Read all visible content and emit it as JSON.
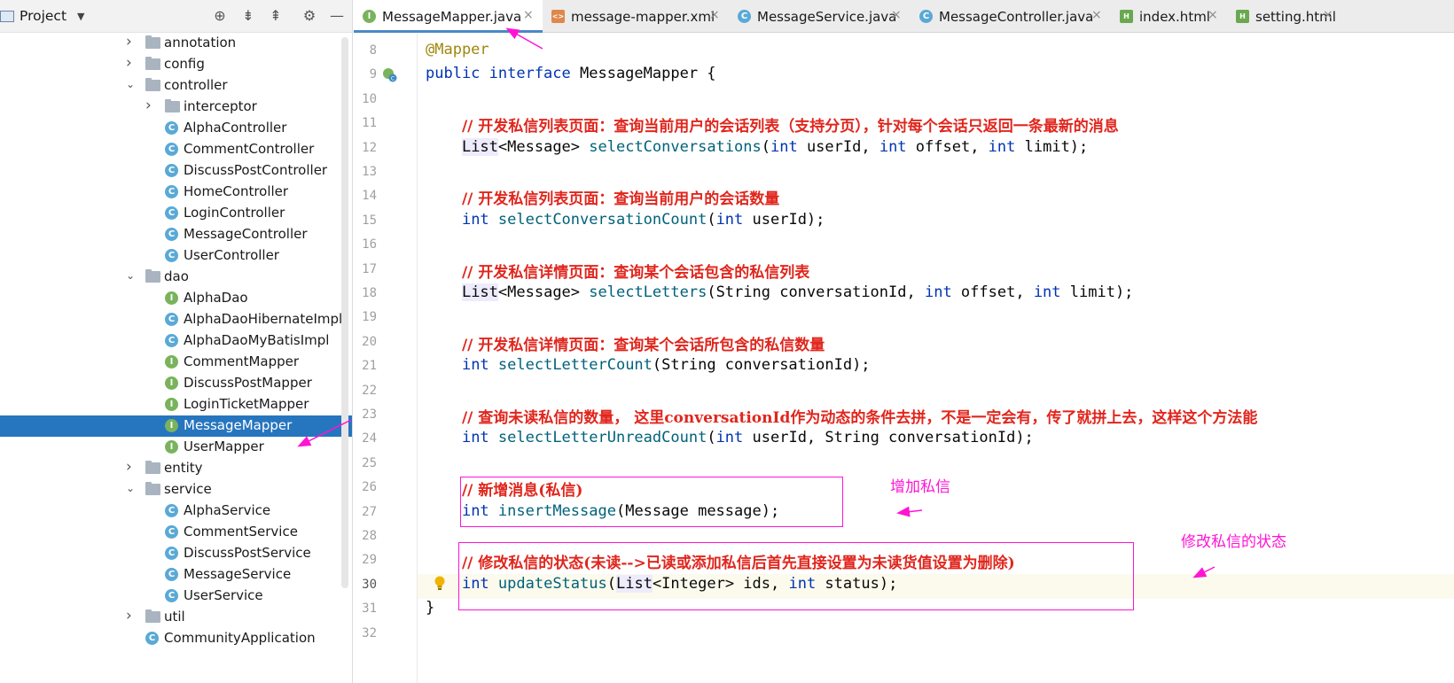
{
  "project_panel": {
    "title": "Project",
    "tools": [
      "locate-icon",
      "expand-all-icon",
      "collapse-all-icon",
      "gear-icon",
      "minimize-icon"
    ],
    "tree": [
      {
        "label": "annotation",
        "kind": "folder",
        "depth": 1,
        "expanded": false
      },
      {
        "label": "config",
        "kind": "folder",
        "depth": 1,
        "expanded": false
      },
      {
        "label": "controller",
        "kind": "folder",
        "depth": 1,
        "expanded": true
      },
      {
        "label": "interceptor",
        "kind": "folder",
        "depth": 2,
        "expanded": false
      },
      {
        "label": "AlphaController",
        "kind": "class",
        "depth": 2
      },
      {
        "label": "CommentController",
        "kind": "class",
        "depth": 2
      },
      {
        "label": "DiscussPostController",
        "kind": "class",
        "depth": 2
      },
      {
        "label": "HomeController",
        "kind": "class",
        "depth": 2
      },
      {
        "label": "LoginController",
        "kind": "class",
        "depth": 2
      },
      {
        "label": "MessageController",
        "kind": "class",
        "depth": 2
      },
      {
        "label": "UserController",
        "kind": "class",
        "depth": 2
      },
      {
        "label": "dao",
        "kind": "folder",
        "depth": 1,
        "expanded": true
      },
      {
        "label": "AlphaDao",
        "kind": "interface",
        "depth": 2
      },
      {
        "label": "AlphaDaoHibernateImpl",
        "kind": "class",
        "depth": 2
      },
      {
        "label": "AlphaDaoMyBatisImpl",
        "kind": "class",
        "depth": 2
      },
      {
        "label": "CommentMapper",
        "kind": "interface",
        "depth": 2
      },
      {
        "label": "DiscussPostMapper",
        "kind": "interface",
        "depth": 2
      },
      {
        "label": "LoginTicketMapper",
        "kind": "interface",
        "depth": 2
      },
      {
        "label": "MessageMapper",
        "kind": "interface",
        "depth": 2,
        "selected": true
      },
      {
        "label": "UserMapper",
        "kind": "interface",
        "depth": 2
      },
      {
        "label": "entity",
        "kind": "folder",
        "depth": 1,
        "expanded": false
      },
      {
        "label": "service",
        "kind": "folder",
        "depth": 1,
        "expanded": true
      },
      {
        "label": "AlphaService",
        "kind": "class",
        "depth": 2
      },
      {
        "label": "CommentService",
        "kind": "class",
        "depth": 2
      },
      {
        "label": "DiscussPostService",
        "kind": "class",
        "depth": 2
      },
      {
        "label": "MessageService",
        "kind": "class",
        "depth": 2
      },
      {
        "label": "UserService",
        "kind": "class",
        "depth": 2
      },
      {
        "label": "util",
        "kind": "folder",
        "depth": 1,
        "expanded": false
      },
      {
        "label": "CommunityApplication",
        "kind": "app",
        "depth": 1
      }
    ]
  },
  "tabs": [
    {
      "label": "MessageMapper.java",
      "icon": "I",
      "type": "interface",
      "active": true
    },
    {
      "label": "message-mapper.xml",
      "icon": "<>",
      "type": "xml"
    },
    {
      "label": "MessageService.java",
      "icon": "C",
      "type": "class"
    },
    {
      "label": "MessageController.java",
      "icon": "C",
      "type": "class"
    },
    {
      "label": "index.html",
      "icon": "H",
      "type": "html"
    },
    {
      "label": "setting.html",
      "icon": "H",
      "type": "html"
    }
  ],
  "tab_close_glyph": "×",
  "editor": {
    "current_line": "30",
    "lines": [
      {
        "no": "8",
        "tokens": [
          {
            "t": "@Mapper",
            "c": "ann"
          }
        ]
      },
      {
        "no": "9",
        "tokens": [
          {
            "t": "public interface ",
            "c": "kw"
          },
          {
            "t": "MessageMapper {",
            "c": "code-text"
          }
        ]
      },
      {
        "no": "10",
        "tokens": []
      },
      {
        "no": "11",
        "tokens": [
          {
            "t": "    "
          },
          {
            "t": "// 开发私信列表页面：查询当前用户的会话列表（支持分页），针对每个会话只返回一条最新的消息",
            "c": "cm"
          }
        ]
      },
      {
        "no": "12",
        "tokens": [
          {
            "t": "    "
          },
          {
            "t": "List",
            "c": "code-text hl-type"
          },
          {
            "t": "<Message> ",
            "c": "code-text"
          },
          {
            "t": "selectConversations",
            "c": "fn"
          },
          {
            "t": "(",
            "c": "code-text"
          },
          {
            "t": "int ",
            "c": "kw"
          },
          {
            "t": "userId, ",
            "c": "code-text"
          },
          {
            "t": "int ",
            "c": "kw"
          },
          {
            "t": "offset, ",
            "c": "code-text"
          },
          {
            "t": "int ",
            "c": "kw"
          },
          {
            "t": "limit);",
            "c": "code-text"
          }
        ]
      },
      {
        "no": "13",
        "tokens": []
      },
      {
        "no": "14",
        "tokens": [
          {
            "t": "    "
          },
          {
            "t": "// 开发私信列表页面：查询当前用户的会话数量",
            "c": "cm"
          }
        ]
      },
      {
        "no": "15",
        "tokens": [
          {
            "t": "    "
          },
          {
            "t": "int ",
            "c": "kw"
          },
          {
            "t": "selectConversationCount",
            "c": "fn"
          },
          {
            "t": "(",
            "c": "code-text"
          },
          {
            "t": "int ",
            "c": "kw"
          },
          {
            "t": "userId);",
            "c": "code-text"
          }
        ]
      },
      {
        "no": "16",
        "tokens": []
      },
      {
        "no": "17",
        "tokens": [
          {
            "t": "    "
          },
          {
            "t": "// 开发私信详情页面：查询某个会话包含的私信列表",
            "c": "cm"
          }
        ]
      },
      {
        "no": "18",
        "tokens": [
          {
            "t": "    "
          },
          {
            "t": "List",
            "c": "code-text hl-type"
          },
          {
            "t": "<Message> ",
            "c": "code-text"
          },
          {
            "t": "selectLetters",
            "c": "fn"
          },
          {
            "t": "(String conversationId, ",
            "c": "code-text"
          },
          {
            "t": "int ",
            "c": "kw"
          },
          {
            "t": "offset, ",
            "c": "code-text"
          },
          {
            "t": "int ",
            "c": "kw"
          },
          {
            "t": "limit);",
            "c": "code-text"
          }
        ]
      },
      {
        "no": "19",
        "tokens": []
      },
      {
        "no": "20",
        "tokens": [
          {
            "t": "    "
          },
          {
            "t": "// 开发私信详情页面：查询某个会话所包含的私信数量",
            "c": "cm"
          }
        ]
      },
      {
        "no": "21",
        "tokens": [
          {
            "t": "    "
          },
          {
            "t": "int ",
            "c": "kw"
          },
          {
            "t": "selectLetterCount",
            "c": "fn"
          },
          {
            "t": "(String conversationId);",
            "c": "code-text"
          }
        ]
      },
      {
        "no": "22",
        "tokens": []
      },
      {
        "no": "23",
        "tokens": [
          {
            "t": "    "
          },
          {
            "t": "// 查询未读私信的数量， 这里conversationId作为动态的条件去拼，不是一定会有，传了就拼上去，这样这个方法能",
            "c": "cm"
          }
        ]
      },
      {
        "no": "24",
        "tokens": [
          {
            "t": "    "
          },
          {
            "t": "int ",
            "c": "kw"
          },
          {
            "t": "selectLetterUnreadCount",
            "c": "fn"
          },
          {
            "t": "(",
            "c": "code-text"
          },
          {
            "t": "int ",
            "c": "kw"
          },
          {
            "t": "userId, String conversationId);",
            "c": "code-text"
          }
        ]
      },
      {
        "no": "25",
        "tokens": []
      },
      {
        "no": "26",
        "tokens": [
          {
            "t": "    "
          },
          {
            "t": "// 新增消息(私信)",
            "c": "cm"
          }
        ]
      },
      {
        "no": "27",
        "tokens": [
          {
            "t": "    "
          },
          {
            "t": "int ",
            "c": "kw"
          },
          {
            "t": "insertMessage",
            "c": "fn"
          },
          {
            "t": "(Message message);",
            "c": "code-text"
          }
        ]
      },
      {
        "no": "28",
        "tokens": []
      },
      {
        "no": "29",
        "tokens": [
          {
            "t": "    "
          },
          {
            "t": "// 修改私信的状态(未读-->已读或添加私信后首先直接设置为未读货值设置为删除)",
            "c": "cm"
          }
        ]
      },
      {
        "no": "30",
        "tokens": [
          {
            "t": "    "
          },
          {
            "t": "int ",
            "c": "kw"
          },
          {
            "t": "updateStatus",
            "c": "fn"
          },
          {
            "t": "(",
            "c": "code-text"
          },
          {
            "t": "List",
            "c": "code-text hl-type"
          },
          {
            "t": "<Integer> ids, ",
            "c": "code-text"
          },
          {
            "t": "int ",
            "c": "kw"
          },
          {
            "t": "status);",
            "c": "code-text"
          }
        ]
      },
      {
        "no": "31",
        "tokens": [
          {
            "t": "}",
            "c": "code-text"
          }
        ]
      },
      {
        "no": "32",
        "tokens": []
      }
    ]
  },
  "annotations": {
    "add_message_note": "增加私信",
    "update_status_note": "修改私信的状态",
    "color": "#ff14d4"
  }
}
